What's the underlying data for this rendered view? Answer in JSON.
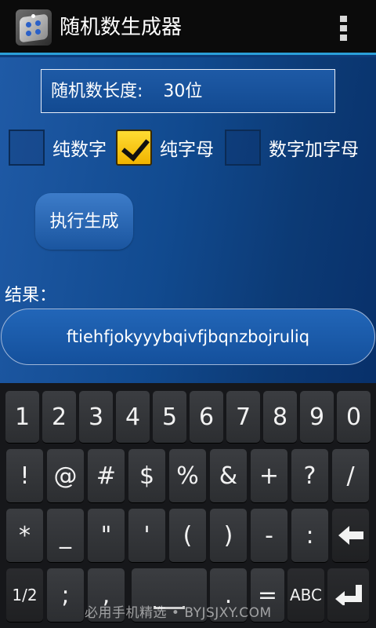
{
  "app": {
    "title": "随机数生成器",
    "icon": "dice-icon",
    "menu_icon": "overflow-menu-icon"
  },
  "form": {
    "length_label": "随机数长度:",
    "length_value": "30位",
    "options": [
      {
        "label": "纯数字",
        "checked": false
      },
      {
        "label": "纯字母",
        "checked": true
      },
      {
        "label": "数字加字母",
        "checked": false
      }
    ],
    "generate_label": "执行生成",
    "result_label": "结果：",
    "result_value": "ftiehfjokyyybqivfjbqnzbojruliq"
  },
  "keyboard": {
    "row1": [
      "1",
      "2",
      "3",
      "4",
      "5",
      "6",
      "7",
      "8",
      "9",
      "0"
    ],
    "row2": [
      "!",
      "@",
      "#",
      "$",
      "%",
      "&",
      "+",
      "?",
      "/"
    ],
    "row3": [
      "*",
      "_",
      "\"",
      "'",
      "(",
      ")",
      "-",
      ":"
    ],
    "row4": {
      "page": "1/2",
      "semicolon": ";",
      "comma": ",",
      "period": ".",
      "equals": "=",
      "abc": "ABC"
    },
    "backspace_icon": "backspace-arrow-icon",
    "enter_icon": "enter-icon"
  },
  "watermark": "必用手机精选 • BYJSJXY.COM",
  "colors": {
    "actionbar": "#0b0b0b",
    "accent": "#2b9fd8",
    "content_bg": "#114a8f",
    "checkbox_checked": "#f5c518",
    "keyboard_bg": "#16171a"
  }
}
